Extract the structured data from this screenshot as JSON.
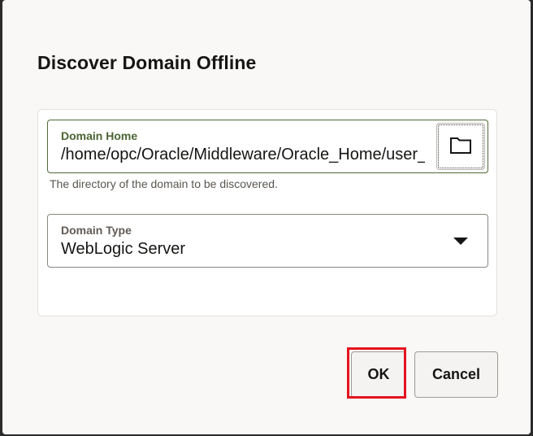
{
  "dialog": {
    "title": "Discover Domain Offline"
  },
  "domain_home": {
    "label": "Domain Home",
    "value": "/home/opc/Oracle/Middleware/Oracle_Home/user_projects/domains/base_domain",
    "helper_text": "The directory of the domain to be discovered.",
    "browse_icon": "folder-icon"
  },
  "domain_type": {
    "label": "Domain Type",
    "value": "WebLogic Server",
    "dropdown_icon": "caret-down-icon"
  },
  "buttons": {
    "ok_label": "OK",
    "cancel_label": "Cancel"
  },
  "colors": {
    "accent_border": "#4f6a35",
    "highlight": "#e3141d"
  }
}
